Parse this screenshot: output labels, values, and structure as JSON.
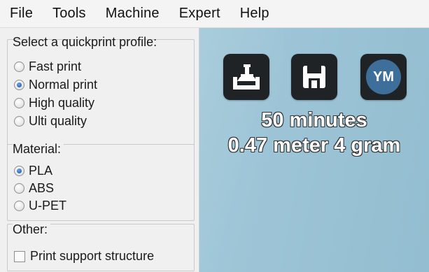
{
  "menu": {
    "file": "File",
    "tools": "Tools",
    "machine": "Machine",
    "expert": "Expert",
    "help": "Help"
  },
  "profile": {
    "title": "Select a quickprint profile:",
    "options": [
      "Fast print",
      "Normal print",
      "High quality",
      "Ulti quality"
    ],
    "selected": "Normal print"
  },
  "material": {
    "title": "Material:",
    "options": [
      "PLA",
      "ABS",
      "U-PET"
    ],
    "selected": "PLA"
  },
  "other": {
    "title": "Other:",
    "support_label": "Print support structure",
    "support_checked": false
  },
  "toolbar": {
    "load_icon": "load-model-icon",
    "save_icon": "save-icon",
    "ym_label": "YM"
  },
  "print_info": {
    "time": "50 minutes",
    "material": "0.47 meter 4 gram"
  },
  "colors": {
    "viewport": "#9cc4d6",
    "tool_button": "#1f2326",
    "ym_circle": "#3d6f9a",
    "radio_selected": "#1f5fb3"
  }
}
